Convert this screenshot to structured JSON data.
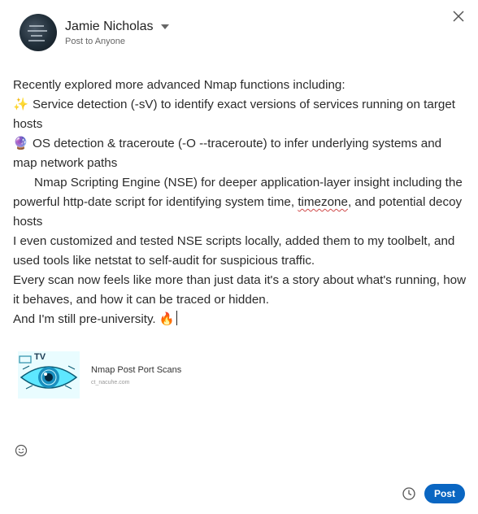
{
  "author": {
    "name": "Jamie Nicholas",
    "visibility": "Post to Anyone"
  },
  "post": {
    "intro": "Recently explored more advanced Nmap functions including:",
    "item1_emoji": "✨",
    "item1_text": "Service detection (-sV) to identify exact versions of services running on target hosts",
    "item2_emoji": "🔮",
    "item2_text": "OS detection & traceroute (-O --traceroute) to infer underlying systems and map network paths",
    "item3_text_before": "Nmap Scripting Engine (NSE) for deeper application-layer insight including the powerful http-date script for identifying system time, ",
    "item3_text_misspelled": "timezone",
    "item3_text_after": ", and potential decoy hosts",
    "para2": "I even customized and tested NSE scripts locally, added them to my toolbelt, and used tools like netstat to self-audit for suspicious traffic.",
    "para3": "Every scan now feels like more than just data it's a story about what's running, how it behaves, and how it can be traced or hidden.",
    "para4": "And I'm still pre-university.",
    "para4_emoji": "🔥"
  },
  "link_preview": {
    "title": "Nmap Post Port Scans",
    "domain": "ct_nacuhe.com",
    "thumb_text": "TV"
  },
  "footer": {
    "post_label": "Post"
  },
  "icons": {
    "close": "close-icon",
    "caret": "chevron-down-icon",
    "emoji": "smiley-icon",
    "schedule": "clock-icon"
  },
  "colors": {
    "accent": "#0a66c2",
    "spellcheck": "#d04a4a"
  }
}
